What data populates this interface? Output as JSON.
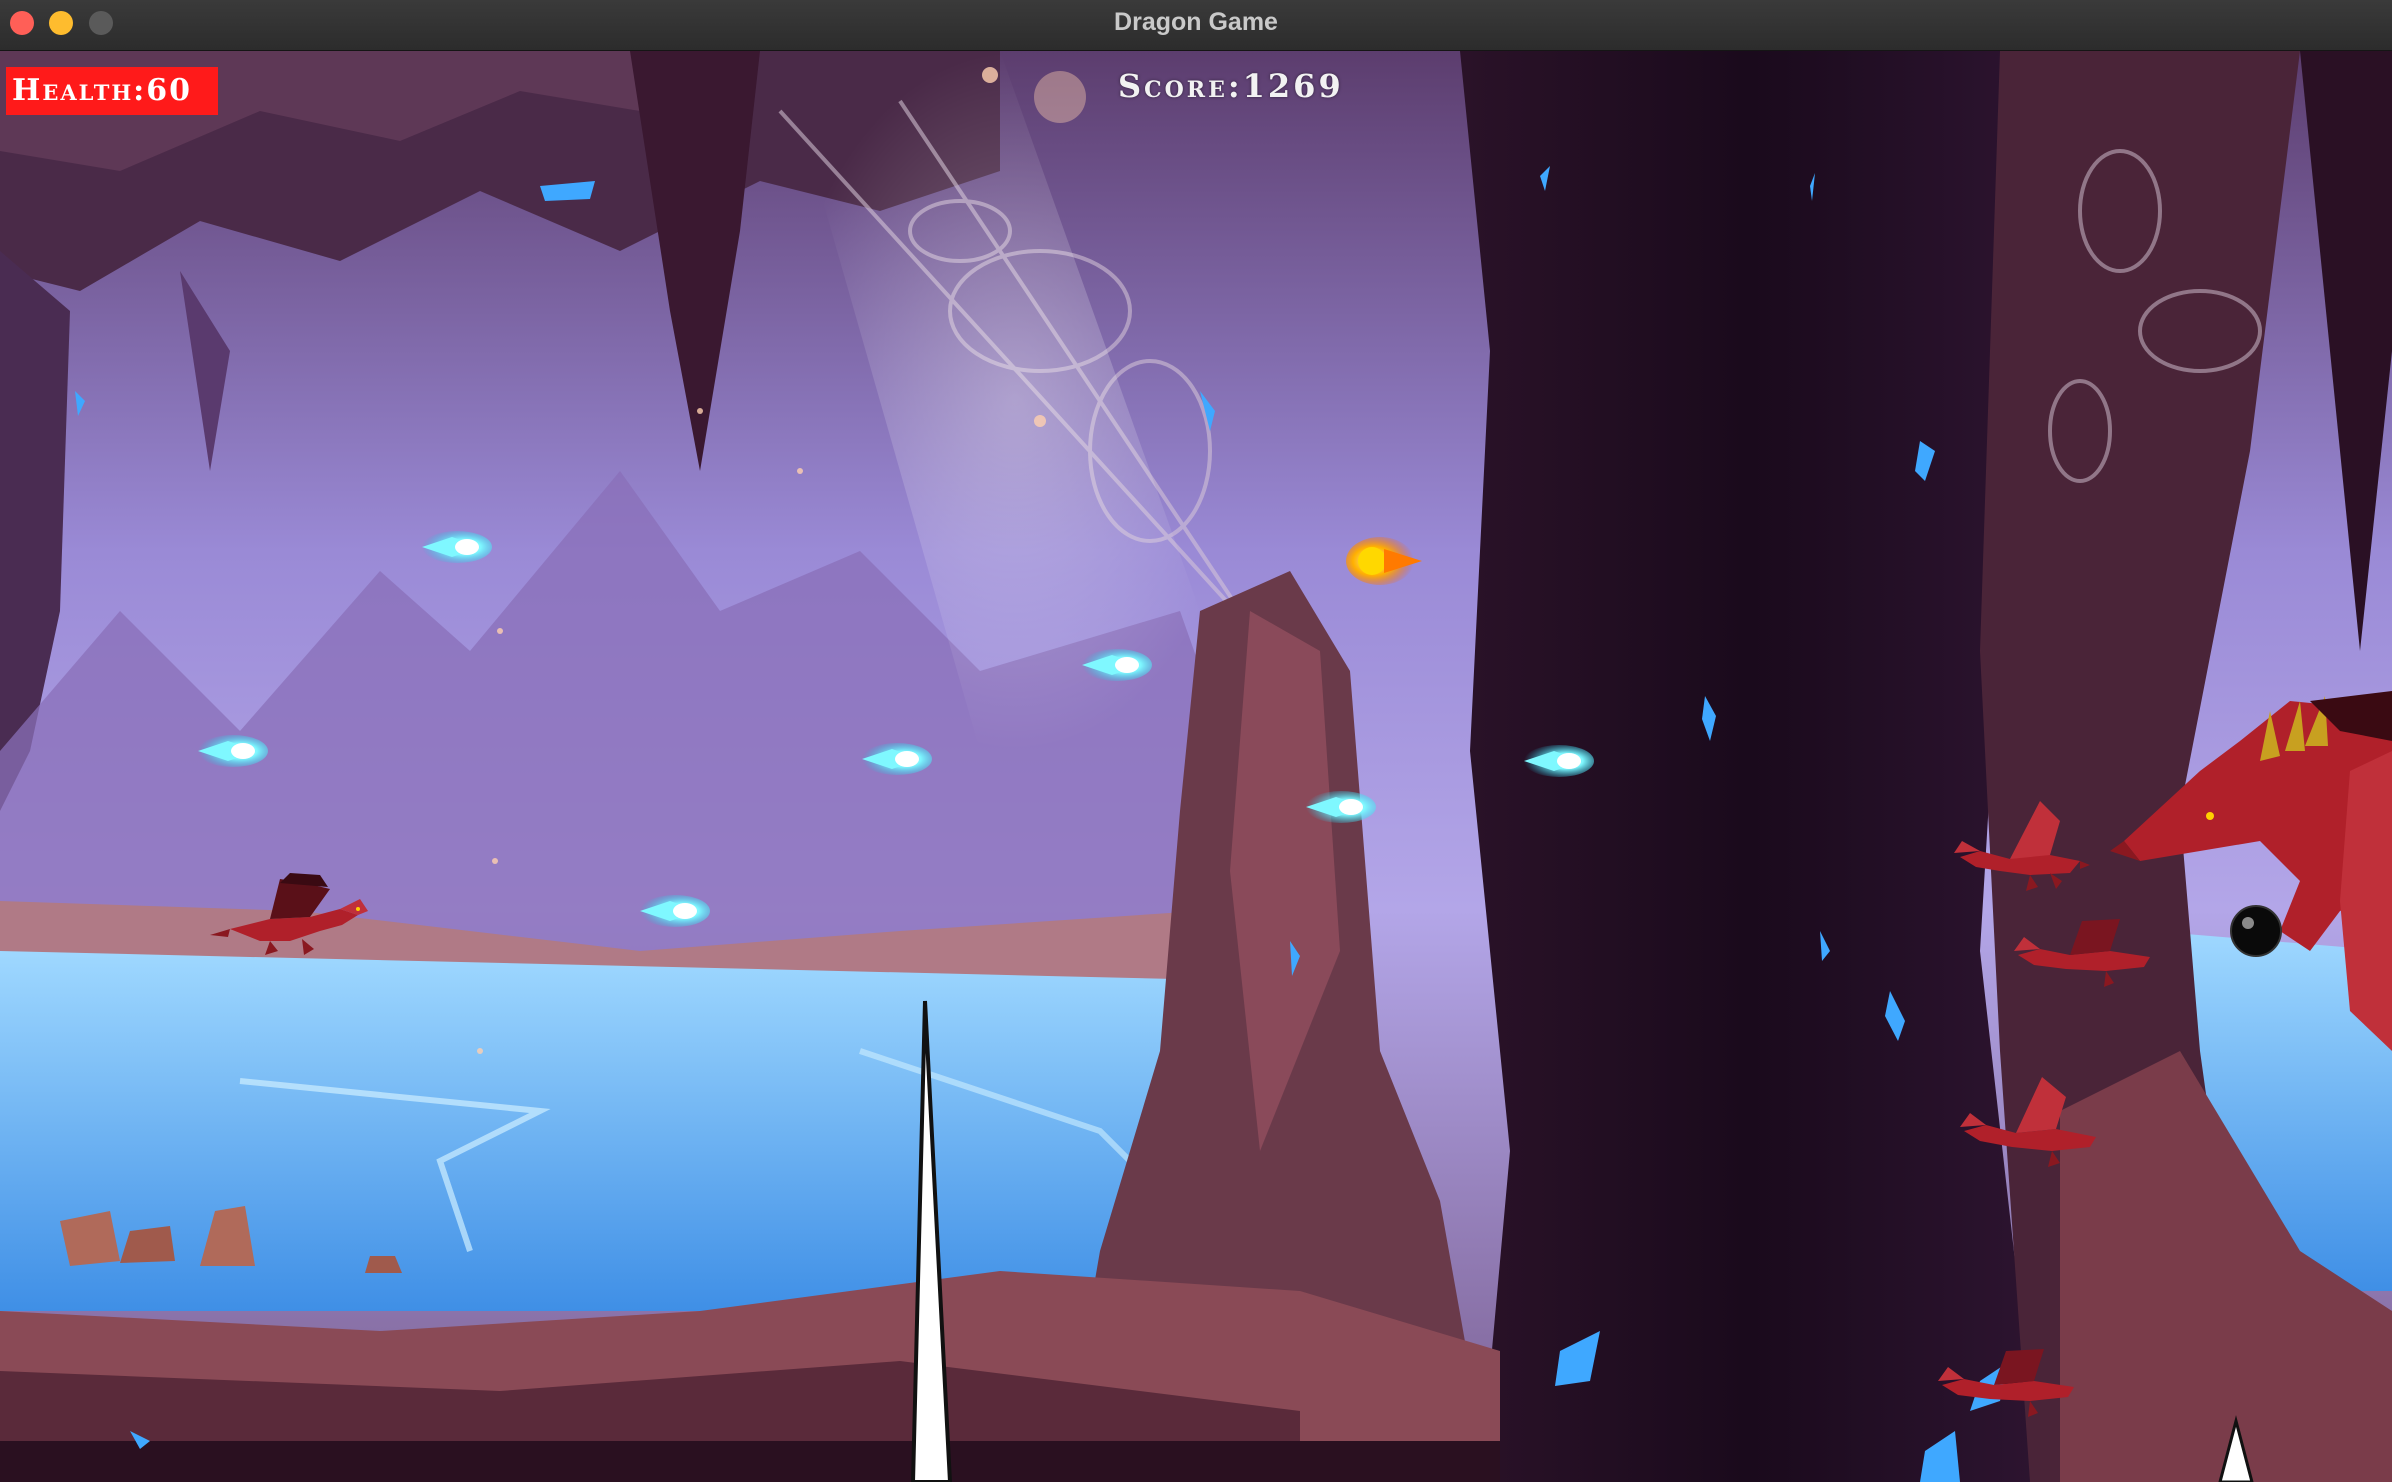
{
  "window": {
    "title": "Dragon Game"
  },
  "hud": {
    "health_text": "Health:60",
    "score_text": "Score:1269"
  },
  "colors": {
    "health_bg": "#ff1a1a",
    "projectile": "#33f0ff",
    "fireball": "#ffb000",
    "dragon": "#b0202a"
  },
  "icons": {
    "player": "dragon",
    "enemy": "dragon",
    "boss": "dragon-boss",
    "hazard": "spike",
    "bomb": "bomb"
  }
}
